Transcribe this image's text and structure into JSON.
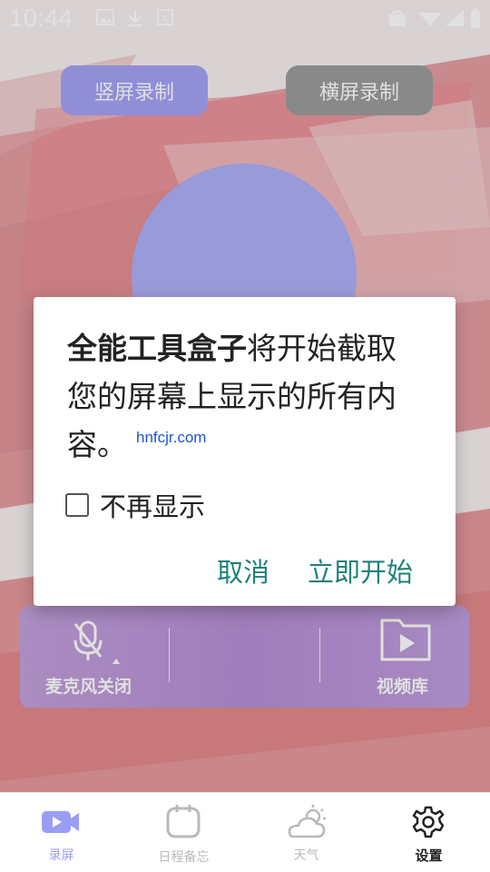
{
  "status_bar": {
    "time": "10:44",
    "left_icons": [
      "image-icon",
      "download-icon",
      "font-icon"
    ],
    "right_icons": [
      "shopping-bag-icon",
      "wifi-icon",
      "signal-icon",
      "battery-icon"
    ]
  },
  "top_buttons": {
    "portrait_label": "竖屏录制",
    "landscape_label": "横屏录制"
  },
  "control_panel": {
    "mic_label": "麦克风关闭",
    "library_label": "视频库"
  },
  "dialog": {
    "app_name": "全能工具盒子",
    "message": "将开始截取您的屏幕上显示的所有内容。",
    "checkbox_label": "不再显示",
    "cancel_label": "取消",
    "start_label": "立即开始"
  },
  "watermark": "hnfcjr.com",
  "bottom_nav": [
    {
      "label": "录屏",
      "icon": "video-camera-icon",
      "active": true
    },
    {
      "label": "日程备忘",
      "icon": "notebook-icon",
      "active": false
    },
    {
      "label": "天气",
      "icon": "weather-icon",
      "active": false
    },
    {
      "label": "设置",
      "icon": "gear-icon",
      "active": false
    }
  ],
  "colors": {
    "accent": "#a6a2f6",
    "dialog_button": "#1f8279",
    "nav_active": "#9b9df5",
    "nav_inactive": "#b9b9b9"
  }
}
